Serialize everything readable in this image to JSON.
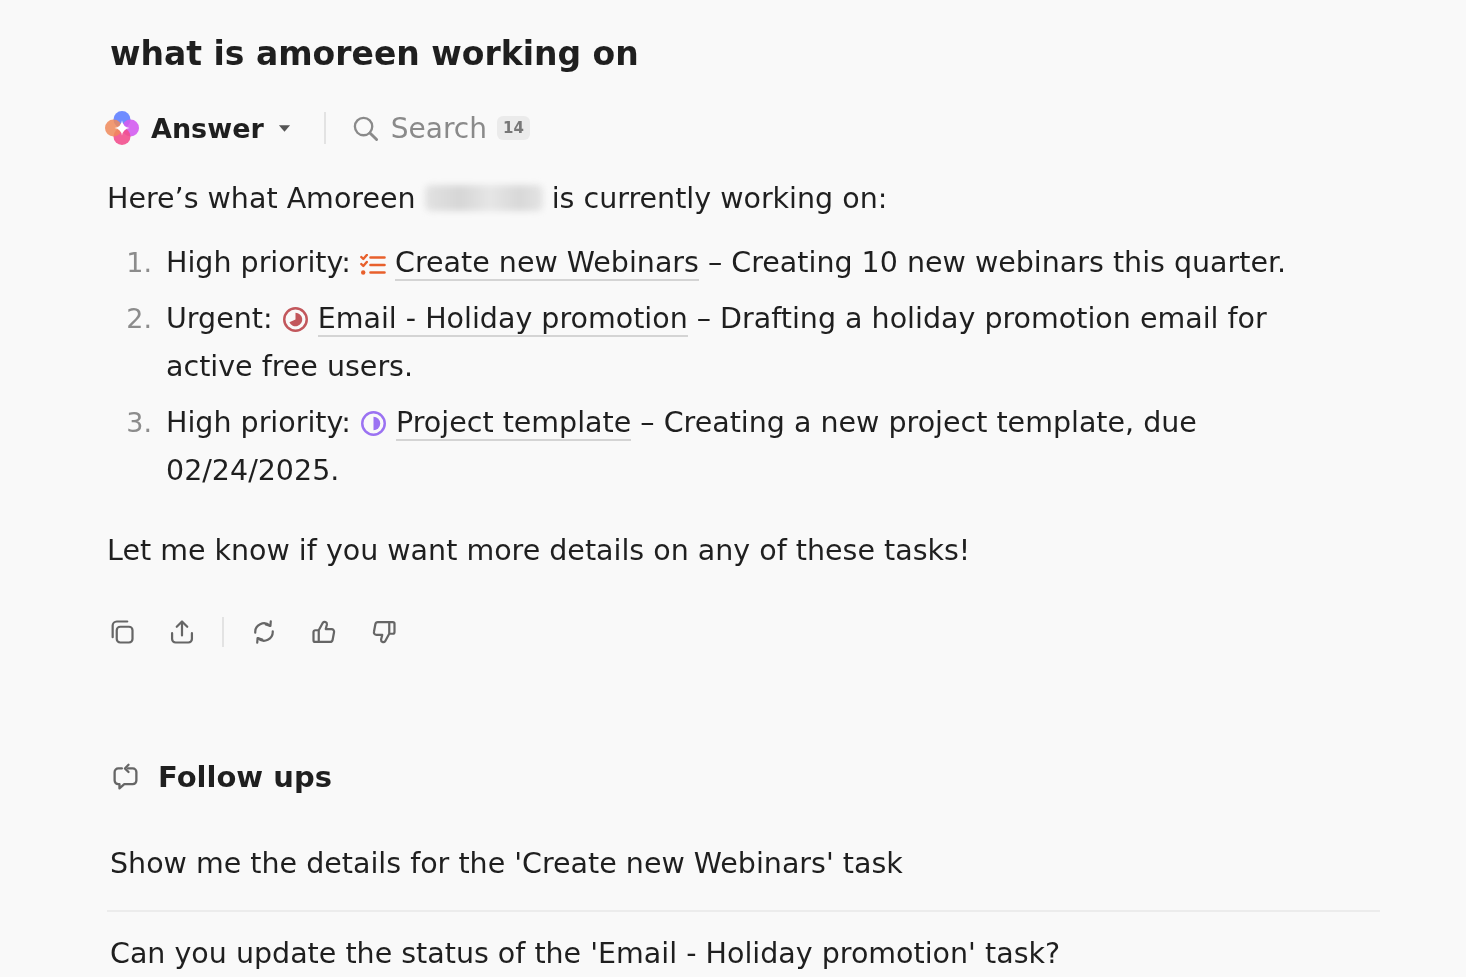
{
  "query_title": "what is amoreen working on",
  "tabs": [
    {
      "kind": "answer",
      "label": "Answer",
      "selected": true
    },
    {
      "kind": "search",
      "label": "Search",
      "count": "14",
      "selected": false
    }
  ],
  "answer": {
    "intro": {
      "before": "Here’s what Amoreen",
      "redacted": true,
      "after": "is currently working on:"
    },
    "items": [
      {
        "number": "1.",
        "label": "High priority:",
        "kind": "checklist",
        "color": "#e8602c",
        "link": "Create new Webinars",
        "text": "– Creating 10 new webinars this quarter."
      },
      {
        "number": "2.",
        "label": "Urgent:",
        "kind": "pie-large",
        "color": "#c2575c",
        "link": "Email - Holiday promotion",
        "text": "– Drafting a holiday promotion email for active free users."
      },
      {
        "number": "3.",
        "label": "High priority:",
        "kind": "pie-half",
        "color": "#9b72f2",
        "link": "Project template",
        "text": "– Creating a new project template, due 02/24/2025."
      }
    ],
    "closing": "Let me know if you want more details on any of these tasks!"
  },
  "follow_ups": {
    "title": "Follow ups",
    "items": [
      "Show me the details for the 'Create new Webinars' task",
      "Can you update the status of the 'Email - Holiday promotion' task?"
    ]
  }
}
